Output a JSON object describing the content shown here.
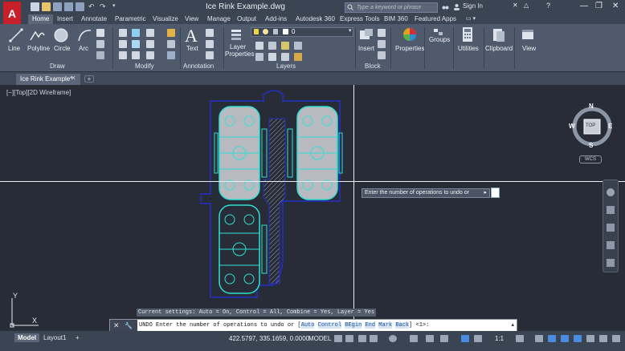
{
  "window": {
    "title": "Ice Rink Example.dwg",
    "app_letter": "A",
    "search_placeholder": "Type a keyword or phrase",
    "signin_label": "Sign In",
    "minimize_glyph": "—",
    "restore_glyph": "❐",
    "close_glyph": "✕"
  },
  "ribbon_tabs": [
    "Home",
    "Insert",
    "Annotate",
    "Parametric",
    "Visualize",
    "View",
    "Manage",
    "Output",
    "Add-ins",
    "Autodesk 360",
    "Express Tools",
    "BIM 360",
    "Featured Apps"
  ],
  "ribbon": {
    "draw": {
      "panel_label": "Draw",
      "line": "Line",
      "polyline": "Polyline",
      "circle": "Circle",
      "arc": "Arc"
    },
    "modify": {
      "panel_label": "Modify"
    },
    "annotation": {
      "panel_label": "Annotation",
      "text": "Text"
    },
    "layers": {
      "panel_label": "Layers",
      "layer_properties_line1": "Layer",
      "layer_properties_line2": "Properties",
      "layer_combo_value": "0"
    },
    "block": {
      "panel_label": "Block",
      "insert": "Insert"
    },
    "properties": "Properties",
    "groups": "Groups",
    "utilities": "Utilities",
    "clipboard": "Clipboard",
    "view": "View"
  },
  "document": {
    "tab_label": "Ice Rink Example*",
    "tab_close": "✕",
    "new_tab": "+"
  },
  "viewport": {
    "label": "[−][Top][2D Wireframe]",
    "viewcube": {
      "north": "N",
      "south": "S",
      "east": "E",
      "west": "W",
      "face": "TOP",
      "wcs": "WCS"
    },
    "ucs_x": "X",
    "ucs_y": "Y"
  },
  "tooltip": {
    "prompt": "Enter the number of operations to undo or",
    "arrow": "▸"
  },
  "command": {
    "history": "Current settings: Auto = On, Control = All, Combine = Yes, Layer = Yes",
    "left_close": "✕",
    "left_wrench": "🔧",
    "prefix": "UNDO Enter the number of operations to undo or [",
    "options": [
      "Auto",
      "Control",
      "BEgin",
      "End",
      "Mark",
      "Back"
    ],
    "suffix": "] <1>:"
  },
  "status": {
    "layout_tabs": [
      "Model",
      "Layout1"
    ],
    "add_layout": "+",
    "coordinates": "422.5797, 335.1659, 0.0000",
    "space": "MODEL",
    "scale": "1:1"
  },
  "colors": {
    "canvas_bg": "#272c36",
    "rink_fill": "#b9b9c0",
    "rink_line": "#2fe0d5",
    "outline_blue": "#2430c8",
    "hatch": "#9aa0b8"
  }
}
